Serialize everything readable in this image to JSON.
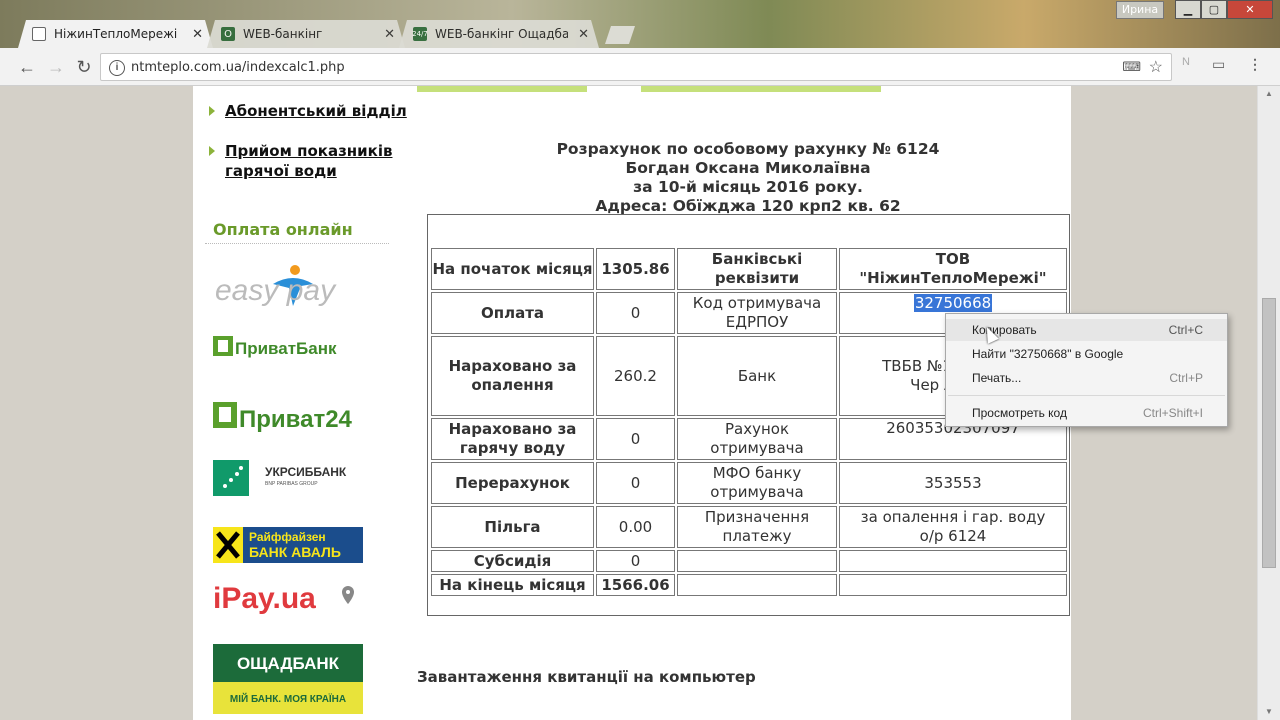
{
  "window": {
    "user": "Ирина",
    "minimize": "▁",
    "maximize": "▢",
    "close": "✕"
  },
  "tabs": [
    {
      "label": "НіжинТеплоМережі",
      "active": true,
      "icon": "page-icon"
    },
    {
      "label": "WEB-банкінг",
      "active": false,
      "icon": "oschadbank-icon"
    },
    {
      "label": "WEB-банкінг Ощадбанк",
      "active": false,
      "icon": "24-7-icon"
    }
  ],
  "address": {
    "url": "ntmteplo.com.ua/indexcalc1.php"
  },
  "sidebar": {
    "menu": [
      "Абонентський відділ",
      "Прийом показників гарячої води"
    ],
    "online_title": "Оплата онлайн",
    "logos": [
      {
        "name": "easypay",
        "text": "easy pay"
      },
      {
        "name": "privatbank",
        "text": "ПриватБанк"
      },
      {
        "name": "privat24",
        "text": "Приват24"
      },
      {
        "name": "ukrsibbank",
        "text": "УКРСИББАНК",
        "sub": "BNP PARIBAS GROUP"
      },
      {
        "name": "raiffeisen",
        "text": "Райффайзен",
        "sub": "БАНК АВАЛЬ"
      },
      {
        "name": "ipay",
        "text": "iPay.ua"
      },
      {
        "name": "oschadbank",
        "text": "ОЩАДБАНК",
        "sub": "МІЙ БАНК. МОЯ КРАЇНА"
      }
    ]
  },
  "summary": {
    "line1": "Розрахунок по особовому рахунку № 6124",
    "line2": "Богдан Оксана Миколаївна",
    "line3": "за 10-й місяць 2016 року.",
    "line4": "Адреса: Обїжджа 120 крп2 кв. 62"
  },
  "table": {
    "rows": [
      {
        "label": "На початок місяця",
        "value": "1305.86",
        "bank_label": "Банківські реквізити",
        "bank_value": "ТОВ \"НіжинТеплоМережі\""
      },
      {
        "label": "Оплата",
        "value": "0",
        "bank_label": "Код отримувача ЕДРПОУ",
        "bank_value": "32750668"
      },
      {
        "label": "Нараховано за опалення",
        "value": "260.2",
        "bank_label": "Банк",
        "bank_value": "ТВБВ №1 м.Н філії Чер АТ\"Ош"
      },
      {
        "label": "Нараховано за гарячу воду",
        "value": "0",
        "bank_label": "Рахунок отримувача",
        "bank_value": "26035302307097"
      },
      {
        "label": "Перерахунок",
        "value": "0",
        "bank_label": "МФО банку отримувача",
        "bank_value": "353553"
      },
      {
        "label": "Пільга",
        "value": "0.00",
        "bank_label": "Призначення платежу",
        "bank_value": "за опалення і гар. воду о/р 6124"
      },
      {
        "label": "Субсидія",
        "value": "0",
        "bank_label": "",
        "bank_value": ""
      },
      {
        "label": "На кінець місяця",
        "value": "1566.06",
        "bank_label": "",
        "bank_value": ""
      }
    ]
  },
  "download_label": "Завантаження квитанції на компьютер",
  "context_menu": [
    {
      "label": "Копировать",
      "shortcut": "Ctrl+C"
    },
    {
      "label": "Найти \"32750668\" в Google",
      "shortcut": ""
    },
    {
      "label": "Печать...",
      "shortcut": "Ctrl+P"
    },
    {
      "label": "Просмотреть код",
      "shortcut": "Ctrl+Shift+I"
    }
  ],
  "colors": {
    "accent_green": "#6a9a2a",
    "selection": "#3875d7"
  }
}
